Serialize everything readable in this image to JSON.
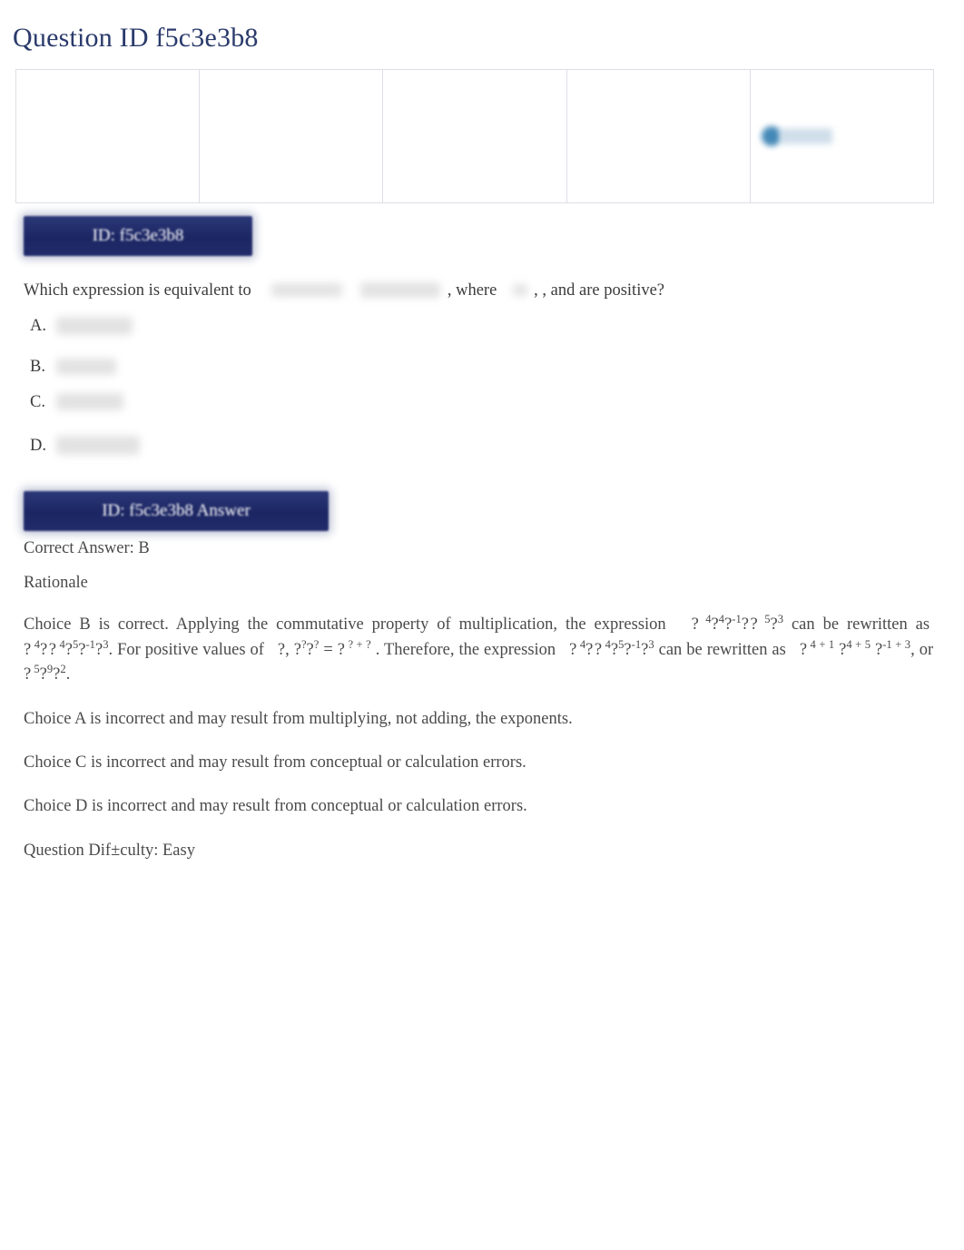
{
  "document": {
    "title": "Question ID f5c3e3b8"
  },
  "top_table": {
    "columns": 5,
    "rows": 1,
    "cells": [
      "",
      "",
      "",
      "",
      ""
    ],
    "marked_cell_index": 4,
    "mark_colors": {
      "dot": "#1b6fa8",
      "bar": "#c7d9e6"
    }
  },
  "badges": {
    "question": "ID: f5c3e3b8",
    "answer": "ID: f5c3e3b8 Answer",
    "color": "#1f2b6c",
    "text_color": "#ffffff"
  },
  "question": {
    "lead_text": "Which expression is equivalent to",
    "after_expression_text": ", where",
    "tail_text": ", ,  and  are  positive?",
    "blurred_expression_count": 2,
    "blurred_variable_count": 1
  },
  "choices": [
    {
      "letter": "A.",
      "content": ""
    },
    {
      "letter": "B.",
      "content": ""
    },
    {
      "letter": "C.",
      "content": ""
    },
    {
      "letter": "D.",
      "content": ""
    }
  ],
  "answer": {
    "correct_answer_label": "Correct Answer: B",
    "rationale_label": "Rationale",
    "rationale": {
      "part1": "Choice B is correct. Applying the commutative property of multiplication, the expression",
      "expr1_base": "?",
      "expr1_rest": "?",
      "part2": "can be rewritten as",
      "part3": ". For positive values of",
      "part4": ". Therefore, the expression",
      "part5": "can be rewritten as",
      "part6": ", or",
      "part7": "."
    },
    "notes": [
      "Choice A is incorrect and may result from multiplying, not adding, the exponents.",
      "Choice C is incorrect and may result from conceptual or calculation errors.",
      "Choice D is incorrect and may result from conceptual or calculation errors."
    ],
    "difficulty": "Question Dif±culty: Easy"
  },
  "math": {
    "expr_a": "? 4?4?-1?? 5?3",
    "expr_b": "? 4?? 4?5?-1?3",
    "expr_identity_left": "?, ??? ?",
    "expr_identity_right": "? ?+?",
    "expr_sum": "? 4+1 ?4+5 ?-1+3",
    "expr_final": "? 5?9?2"
  },
  "colors": {
    "title": "#2a3a6b",
    "badge": "#1f2b6c",
    "body_text": "#4a4a4a",
    "table_border": "#dcdfe5",
    "background": "#ffffff"
  }
}
